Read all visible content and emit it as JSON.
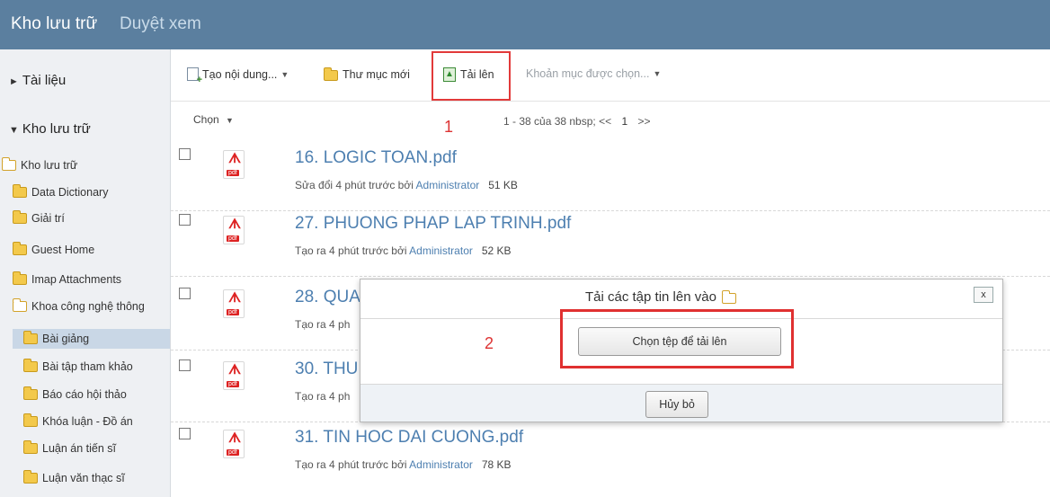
{
  "title": {
    "app": "Kho lưu trữ",
    "section": "Duyệt xem"
  },
  "sidebar": {
    "documents_label": "Tài liệu",
    "repository_label": "Kho lưu trữ",
    "tree": [
      {
        "label": "Kho lưu trữ",
        "icon": "folder-open-icon",
        "level": 0,
        "selected": false
      },
      {
        "label": "Data Dictionary",
        "icon": "folder-icon",
        "level": 1,
        "selected": false
      },
      {
        "label": "Giải trí",
        "icon": "folder-icon",
        "level": 1,
        "selected": false
      },
      {
        "label": "Guest Home",
        "icon": "folder-icon",
        "level": 1,
        "selected": false
      },
      {
        "label": "Imap Attachments",
        "icon": "folder-icon",
        "level": 1,
        "selected": false
      },
      {
        "label": "Khoa công nghệ thông",
        "icon": "folder-open-icon",
        "level": 1,
        "selected": false
      },
      {
        "label": "Bài giảng",
        "icon": "folder-icon",
        "level": 2,
        "selected": true
      },
      {
        "label": "Bài tập tham khảo",
        "icon": "folder-icon",
        "level": 2,
        "selected": false
      },
      {
        "label": "Báo cáo hội thảo",
        "icon": "folder-icon",
        "level": 2,
        "selected": false
      },
      {
        "label": "Khóa luận - Đồ án",
        "icon": "folder-icon",
        "level": 2,
        "selected": false
      },
      {
        "label": "Luận án tiến sĩ",
        "icon": "folder-icon",
        "level": 2,
        "selected": false
      },
      {
        "label": "Luận văn thạc sĩ",
        "icon": "folder-icon",
        "level": 2,
        "selected": false
      }
    ]
  },
  "toolbar": {
    "create_content": "Tạo nội dung...",
    "new_folder": "Thư mục mới",
    "upload": "Tải lên",
    "selected_items": "Khoản mục được chọn...",
    "annotation_1": "1"
  },
  "listbar": {
    "select_label": "Chọn",
    "pager_text": "1 - 38 của 38 nbsp; <<",
    "page_current": "1",
    "pager_next": ">>"
  },
  "files": [
    {
      "name": "16. LOGIC TOAN.pdf",
      "meta_prefix": "Sửa đổi 4 phút trước bởi",
      "user": "Administrator",
      "size": "51 KB"
    },
    {
      "name": "27. PHUONG PHAP LAP TRINH.pdf",
      "meta_prefix": "Tạo ra 4 phút trước bởi",
      "user": "Administrator",
      "size": "52 KB"
    },
    {
      "name": "28. QUA",
      "meta_prefix": "Tạo ra 4 ph",
      "user": "",
      "size": ""
    },
    {
      "name": "30. THU",
      "meta_prefix": "Tạo ra 4 ph",
      "user": "",
      "size": ""
    },
    {
      "name": "31. TIN HOC DAI CUONG.pdf",
      "meta_prefix": "Tạo ra 4 phút trước bởi",
      "user": "Administrator",
      "size": "78 KB"
    }
  ],
  "dialog": {
    "title": "Tải các tập tin lên vào",
    "close_label": "x",
    "choose_button": "Chọn tệp để tải lên",
    "cancel_button": "Hủy bỏ",
    "annotation_2": "2"
  },
  "colors": {
    "header_bg": "#5b7f9f",
    "link": "#4d7fb0",
    "highlight": "#e03030",
    "selected_folder": "#c9d7e6"
  }
}
